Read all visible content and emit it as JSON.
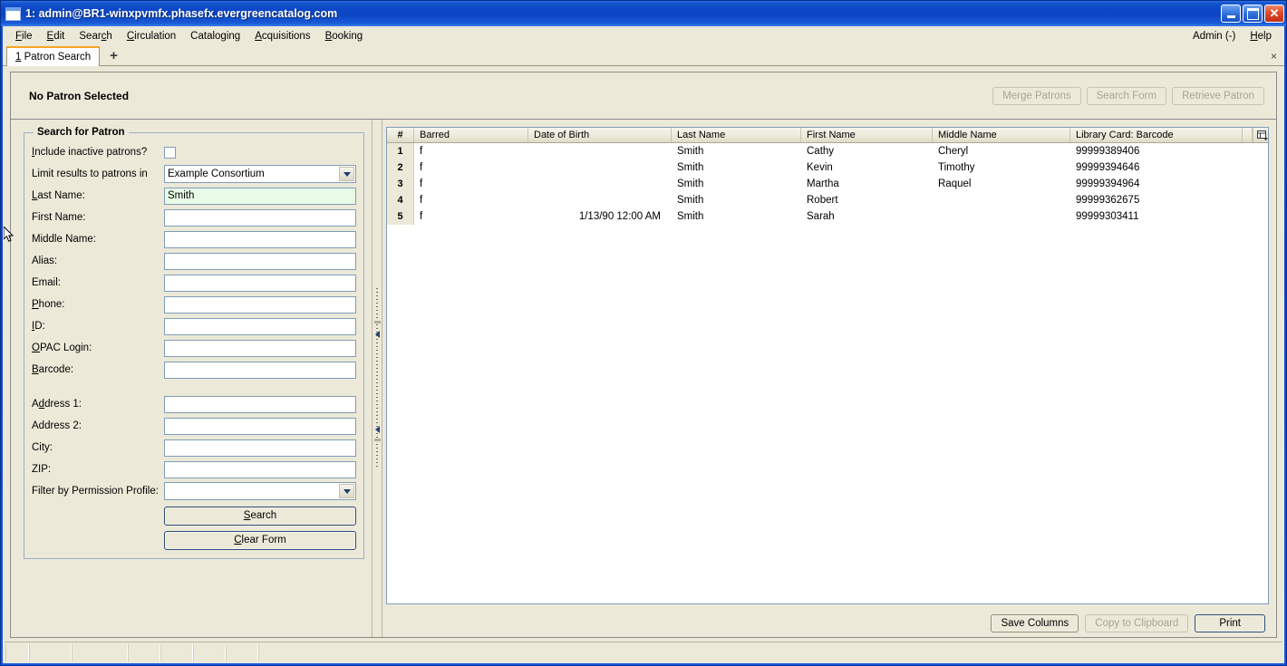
{
  "window": {
    "title": "1: admin@BR1-winxpvmfx.phasefx.evergreencatalog.com",
    "icon": "window-icon",
    "minimize_label": "",
    "maximize_label": "",
    "close_label": ""
  },
  "menubar": {
    "items": [
      {
        "label": "File"
      },
      {
        "label": "Edit"
      },
      {
        "label": "Search"
      },
      {
        "label": "Circulation"
      },
      {
        "label": "Cataloging"
      },
      {
        "label": "Acquisitions"
      },
      {
        "label": "Booking"
      }
    ],
    "right_items": [
      {
        "label": "Admin (-)"
      },
      {
        "label": "Help"
      }
    ]
  },
  "tabs": {
    "active": {
      "label": "1 Patron Search"
    },
    "add_label": "+",
    "close_all_label": "×"
  },
  "patron_summary": {
    "title": "No Patron Selected",
    "buttons": [
      {
        "label": "Merge Patrons",
        "disabled": true
      },
      {
        "label": "Search Form",
        "disabled": true
      },
      {
        "label": "Retrieve Patron",
        "disabled": true
      }
    ]
  },
  "search_form": {
    "legend": "Search for Patron",
    "include_inactive_label": "Include inactive patrons?",
    "include_inactive_checked": false,
    "limit_label": "Limit results to patrons in",
    "limit_value": "Example Consortium",
    "fields": [
      {
        "label": "Last Name:",
        "value": "Smith",
        "focused": true
      },
      {
        "label": "First Name:",
        "value": "",
        "focused": false
      },
      {
        "label": "Middle Name:",
        "value": "",
        "focused": false
      },
      {
        "label": "Alias:",
        "value": "",
        "focused": false
      },
      {
        "label": "Email:",
        "value": "",
        "focused": false
      },
      {
        "label": "Phone:",
        "value": "",
        "focused": false
      },
      {
        "label": "ID:",
        "value": "",
        "focused": false
      },
      {
        "label": "OPAC Login:",
        "value": "",
        "focused": false
      },
      {
        "label": "Barcode:",
        "value": "",
        "focused": false
      }
    ],
    "address_fields": [
      {
        "label": "Address 1:",
        "value": ""
      },
      {
        "label": "Address 2:",
        "value": ""
      },
      {
        "label": "City:",
        "value": ""
      },
      {
        "label": "ZIP:",
        "value": ""
      }
    ],
    "permission_label": "Filter by Permission Profile:",
    "permission_value": "",
    "search_button": "Search",
    "clear_button": "Clear Form"
  },
  "results": {
    "columns": [
      {
        "key": "num",
        "label": "#"
      },
      {
        "key": "barred",
        "label": "Barred"
      },
      {
        "key": "dob",
        "label": "Date of Birth"
      },
      {
        "key": "last",
        "label": "Last Name"
      },
      {
        "key": "first",
        "label": "First Name"
      },
      {
        "key": "middle",
        "label": "Middle Name"
      },
      {
        "key": "card",
        "label": "Library Card: Barcode"
      }
    ],
    "rows": [
      {
        "num": "1",
        "barred": "f",
        "dob": "",
        "last": "Smith",
        "first": "Cathy",
        "middle": "Cheryl",
        "card": "99999389406"
      },
      {
        "num": "2",
        "barred": "f",
        "dob": "",
        "last": "Smith",
        "first": "Kevin",
        "middle": "Timothy",
        "card": "99999394646"
      },
      {
        "num": "3",
        "barred": "f",
        "dob": "",
        "last": "Smith",
        "first": "Martha",
        "middle": "Raquel",
        "card": "99999394964"
      },
      {
        "num": "4",
        "barred": "f",
        "dob": "",
        "last": "Smith",
        "first": "Robert",
        "middle": "",
        "card": "99999362675"
      },
      {
        "num": "5",
        "barred": "f",
        "dob": "1/13/90 12:00 AM",
        "last": "Smith",
        "first": "Sarah",
        "middle": "",
        "card": "99999303411"
      }
    ],
    "column_picker_icon": "column-picker-icon",
    "actions": [
      {
        "label": "Save Columns",
        "disabled": false,
        "accent": false
      },
      {
        "label": "Copy to Clipboard",
        "disabled": true,
        "accent": false
      },
      {
        "label": "Print",
        "disabled": false,
        "accent": true
      }
    ]
  },
  "splitter": {
    "collapse_left_label": "",
    "collapse_right_label": ""
  },
  "statusbar": {
    "cells": [
      "",
      "",
      "",
      "",
      "",
      "",
      "",
      ""
    ]
  },
  "colors": {
    "titlebar_blue": "#0c46c4",
    "window_face": "#ece9d8",
    "tab_accent": "#f5a623",
    "field_border": "#7f9db9",
    "focused_field_bg": "#e8fbe6",
    "disabled_text": "#a7a595"
  }
}
